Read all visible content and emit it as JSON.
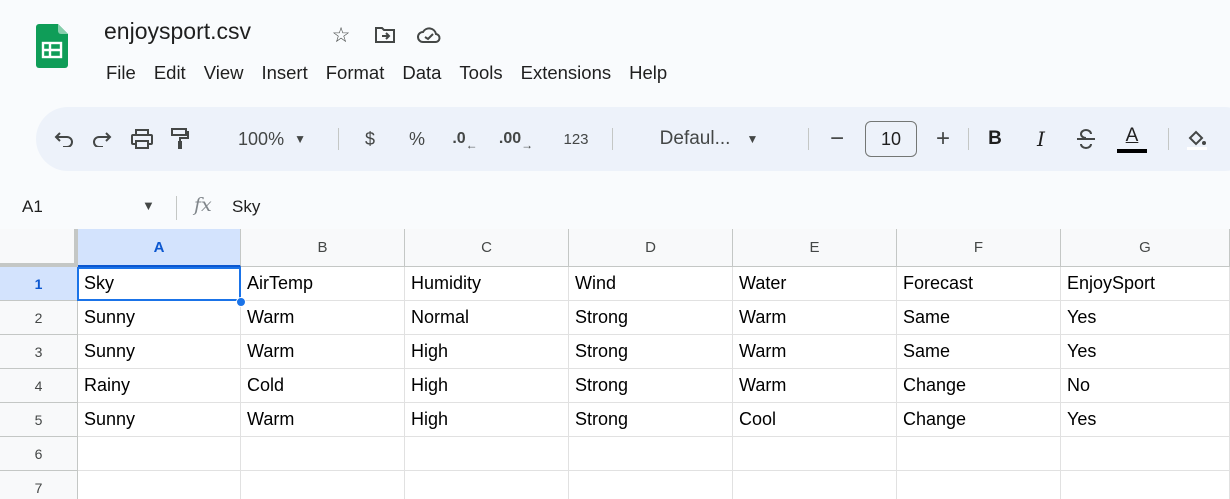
{
  "doc": {
    "title": "enjoysport.csv",
    "icons": [
      "star-icon",
      "move-to-folder-icon",
      "cloud-saved-icon"
    ]
  },
  "menu": [
    "File",
    "Edit",
    "View",
    "Insert",
    "Format",
    "Data",
    "Tools",
    "Extensions",
    "Help"
  ],
  "toolbar": {
    "zoom": "100%",
    "currency": "$",
    "percent": "%",
    "decrease_decimal": ".0",
    "increase_decimal": ".00",
    "number_format": "123",
    "font": "Defaul...",
    "font_size": "10",
    "minus": "−",
    "plus": "+",
    "bold": "B",
    "italic": "I",
    "text_color": "A"
  },
  "formula_bar": {
    "name_box": "A1",
    "fx": "fx",
    "value": "Sky"
  },
  "grid": {
    "columns": [
      "A",
      "B",
      "C",
      "D",
      "E",
      "F",
      "G"
    ],
    "row_numbers": [
      "1",
      "2",
      "3",
      "4",
      "5",
      "6",
      "7"
    ],
    "rows": [
      [
        "Sky",
        "AirTemp",
        "Humidity",
        "Wind",
        "Water",
        "Forecast",
        "EnjoySport"
      ],
      [
        "Sunny",
        "Warm",
        "Normal",
        "Strong",
        "Warm",
        "Same",
        "Yes"
      ],
      [
        "Sunny",
        "Warm",
        "High",
        "Strong",
        "Warm",
        "Same",
        "Yes"
      ],
      [
        "Rainy",
        "Cold",
        "High",
        "Strong",
        "Warm",
        "Change",
        "No"
      ],
      [
        "Sunny",
        "Warm",
        "High",
        "Strong",
        "Cool",
        "Change",
        "Yes"
      ],
      [
        "",
        "",
        "",
        "",
        "",
        "",
        ""
      ],
      [
        "",
        "",
        "",
        "",
        "",
        "",
        ""
      ]
    ],
    "active_cell": "A1"
  },
  "colors": {
    "accent": "#1a73e8",
    "selected_header_bg": "#d3e3fd",
    "toolbar_bg": "#edf2fa",
    "logo_green": "#0f9d58"
  }
}
